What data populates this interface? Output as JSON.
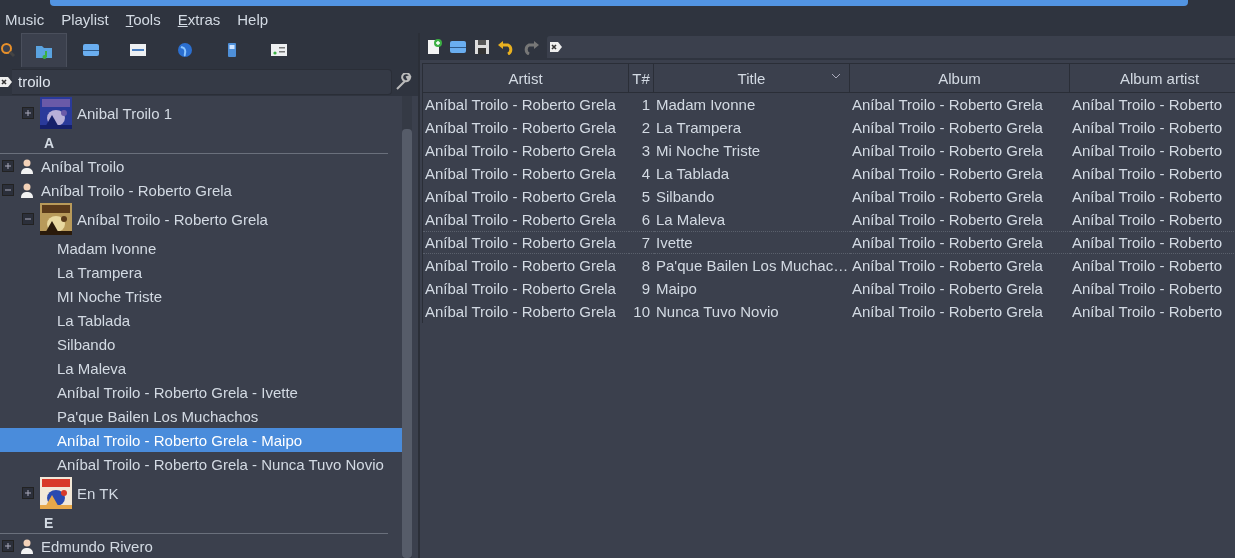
{
  "menu": [
    {
      "label": "Music",
      "mnemonic": false
    },
    {
      "label": "Playlist",
      "mnemonic": false
    },
    {
      "label": "Tools",
      "mnemonic": true
    },
    {
      "label": "Extras",
      "mnemonic": true
    },
    {
      "label": "Help",
      "mnemonic": false
    }
  ],
  "library_tabs": [
    {
      "selected": false
    },
    {
      "selected": true
    },
    {
      "selected": false
    },
    {
      "selected": false
    },
    {
      "selected": false
    },
    {
      "selected": false
    },
    {
      "selected": false
    }
  ],
  "search": {
    "value": "troilo"
  },
  "tree": [
    {
      "kind": "album",
      "label": "Anibal Troilo 1",
      "expanded": false,
      "selected": false
    },
    {
      "kind": "divider",
      "label": "A"
    },
    {
      "kind": "artist",
      "label": "Aníbal Troilo",
      "expanded": false,
      "selected": false
    },
    {
      "kind": "artist",
      "label": "Aníbal Troilo - Roberto Grela",
      "expanded": true,
      "selected": false,
      "children": [
        {
          "kind": "album",
          "label": "Aníbal Troilo - Roberto Grela",
          "expanded": true,
          "selected": false,
          "children": [
            {
              "kind": "track",
              "label": "Madam Ivonne",
              "selected": false
            },
            {
              "kind": "track",
              "label": "La Trampera",
              "selected": false
            },
            {
              "kind": "track",
              "label": "MI Noche Triste",
              "selected": false
            },
            {
              "kind": "track",
              "label": "La Tablada",
              "selected": false
            },
            {
              "kind": "track",
              "label": "Silbando",
              "selected": false
            },
            {
              "kind": "track",
              "label": "La Maleva",
              "selected": false
            },
            {
              "kind": "track",
              "label": "Aníbal Troilo - Roberto Grela - Ivette",
              "selected": false
            },
            {
              "kind": "track",
              "label": "Pa'que Bailen Los Muchachos",
              "selected": false
            },
            {
              "kind": "track",
              "label": "Aníbal Troilo - Roberto Grela - Maipo",
              "selected": true
            },
            {
              "kind": "track",
              "label": "Aníbal Troilo - Roberto Grela - Nunca Tuvo Novio",
              "selected": false
            }
          ]
        },
        {
          "kind": "album",
          "label": "En TK",
          "expanded": false,
          "selected": false
        }
      ]
    },
    {
      "kind": "divider",
      "label": "E"
    },
    {
      "kind": "artist",
      "label": "Edmundo Rivero",
      "expanded": false,
      "selected": false
    }
  ],
  "playlist": {
    "columns": [
      {
        "label": "Artist",
        "sorted": false
      },
      {
        "label": "T#",
        "sorted": false
      },
      {
        "label": "Title",
        "sorted": true
      },
      {
        "label": "Album",
        "sorted": false
      },
      {
        "label": "Album artist",
        "sorted": false
      }
    ],
    "rows": [
      {
        "cells": [
          "Aníbal Troilo - Roberto Grela",
          "1",
          "Madam Ivonne",
          "Aníbal Troilo - Roberto Grela",
          "Aníbal Troilo - Roberto"
        ],
        "focused": false
      },
      {
        "cells": [
          "Aníbal Troilo - Roberto Grela",
          "2",
          "La Trampera",
          "Aníbal Troilo - Roberto Grela",
          "Aníbal Troilo - Roberto"
        ],
        "focused": false
      },
      {
        "cells": [
          "Aníbal Troilo - Roberto Grela",
          "3",
          "Mi Noche Triste",
          "Aníbal Troilo - Roberto Grela",
          "Aníbal Troilo - Roberto"
        ],
        "focused": false
      },
      {
        "cells": [
          "Aníbal Troilo - Roberto Grela",
          "4",
          "La Tablada",
          "Aníbal Troilo - Roberto Grela",
          "Aníbal Troilo - Roberto"
        ],
        "focused": false
      },
      {
        "cells": [
          "Aníbal Troilo - Roberto Grela",
          "5",
          "Silbando",
          "Aníbal Troilo - Roberto Grela",
          "Aníbal Troilo - Roberto"
        ],
        "focused": false
      },
      {
        "cells": [
          "Aníbal Troilo - Roberto Grela",
          "6",
          "La Maleva",
          "Aníbal Troilo - Roberto Grela",
          "Aníbal Troilo - Roberto"
        ],
        "focused": false
      },
      {
        "cells": [
          "Aníbal Troilo - Roberto Grela",
          "7",
          "Ivette",
          "Aníbal Troilo - Roberto Grela",
          "Aníbal Troilo - Roberto"
        ],
        "focused": true
      },
      {
        "cells": [
          "Aníbal Troilo - Roberto Grela",
          "8",
          "Pa'que Bailen Los Muchac…",
          "Aníbal Troilo - Roberto Grela",
          "Aníbal Troilo - Roberto"
        ],
        "focused": false
      },
      {
        "cells": [
          "Aníbal Troilo - Roberto Grela",
          "9",
          "Maipo",
          "Aníbal Troilo - Roberto Grela",
          "Aníbal Troilo - Roberto"
        ],
        "focused": false
      },
      {
        "cells": [
          "Aníbal Troilo - Roberto Grela",
          "10",
          "Nunca Tuvo Novio",
          "Aníbal Troilo - Roberto Grela",
          "Aníbal Troilo - Roberto"
        ],
        "focused": false
      }
    ]
  }
}
